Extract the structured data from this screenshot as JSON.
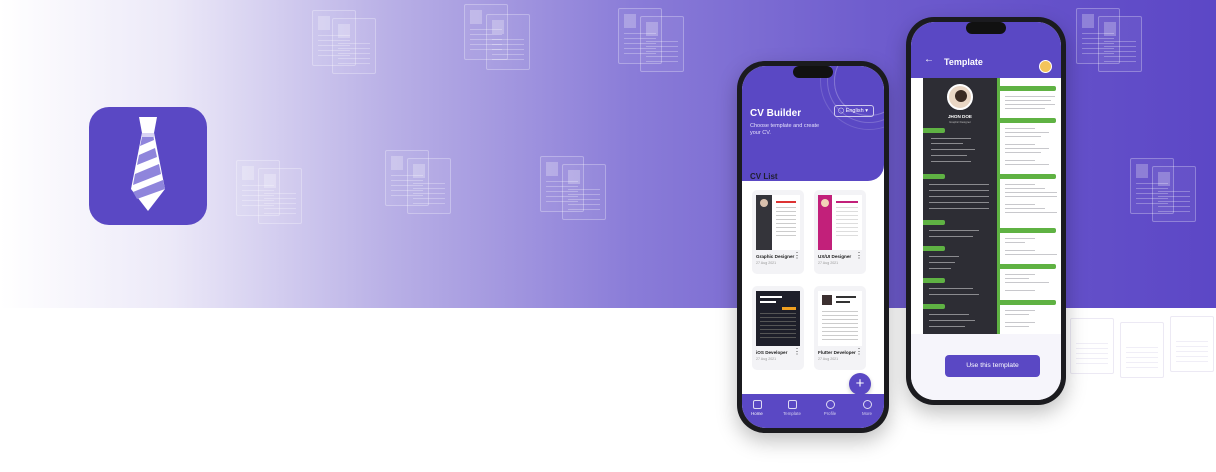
{
  "colors": {
    "primary": "#5a48c4",
    "accent_green": "#5fb243",
    "dark_panel": "#2d2d34"
  },
  "app_icon": {
    "icon": "tie-icon"
  },
  "phone_list": {
    "header_title": "CV Builder",
    "header_subtitle": "Choose template and create your CV.",
    "language_label": "English",
    "language_icon": "globe-icon",
    "section_title": "CV List",
    "cards": [
      {
        "name": "Graphic Designer",
        "date": "27 Aug 2021"
      },
      {
        "name": "UX/UI Designer",
        "date": "27 Aug 2021"
      },
      {
        "name": "iOS Developer",
        "date": "27 Aug 2021"
      },
      {
        "name": "Flutter Developer",
        "date": "27 Aug 2021"
      }
    ],
    "fab_label": "+",
    "nav": [
      {
        "label": "Home",
        "icon": "home-icon"
      },
      {
        "label": "Template",
        "icon": "template-icon"
      },
      {
        "label": "Profile",
        "icon": "profile-icon"
      },
      {
        "label": "More",
        "icon": "more-icon"
      }
    ]
  },
  "phone_template": {
    "back_icon": "arrow-left-icon",
    "title": "Template",
    "avatar_icon": "user-avatar-icon",
    "cv_name": "JHON DOE",
    "cv_role": "Graphic Designer",
    "button_label": "Use this template"
  }
}
